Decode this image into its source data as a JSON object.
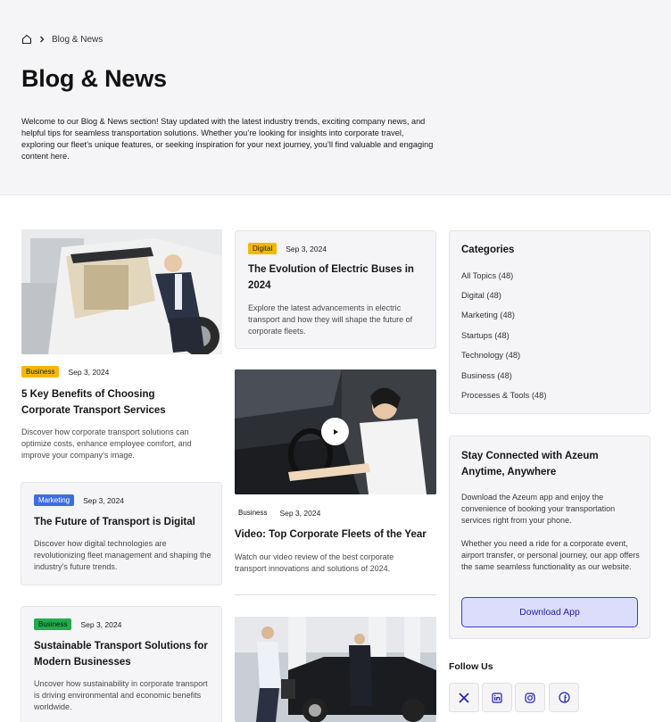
{
  "breadcrumb": {
    "home_icon": "home-icon",
    "separator_icon": "chevron-right-icon",
    "current": "Blog & News"
  },
  "page": {
    "title": "Blog & News",
    "intro": "Welcome to our Blog & News section! Stay updated with the latest industry trends, exciting company news, and helpful tips for seamless transportation solutions. Whether you’re looking for insights into corporate travel, exploring our fleet’s unique features, or seeking inspiration for your next journey, you’ll find valuable and engaging content here."
  },
  "posts": {
    "left": [
      {
        "tag": "Business",
        "date": "Sep 3, 2024",
        "title": "5 Key Benefits of Choosing Corporate Transport Services",
        "excerpt": "Discover how corporate transport solutions can optimize costs, enhance employee comfort, and improve your company’s image."
      },
      {
        "tag": "Marketing",
        "date": "Sep 3, 2024",
        "title": "The Future of Transport is Digital",
        "excerpt": "Discover how digital technologies are revolutionizing fleet management and shaping the industry’s future trends."
      },
      {
        "tag": "Business",
        "date": "Sep 3, 2024",
        "title": "Sustainable Transport Solutions for Modern Businesses",
        "excerpt": "Uncover how sustainability in corporate transport is driving environmental and economic benefits worldwide."
      }
    ],
    "middle": [
      {
        "tag": "Digital",
        "date": "Sep 3, 2024",
        "title": "The Evolution of Electric Buses in 2024",
        "excerpt": "Explore the latest advancements in electric transport and how they will shape the future of corporate fleets."
      },
      {
        "tag": "Business",
        "date": "Sep 3, 2024",
        "title": "Video: Top Corporate Fleets of the Year",
        "excerpt": "Watch our video review of the best corporate transport innovations and solutions of 2024."
      }
    ]
  },
  "sidebar": {
    "categories_title": "Categories",
    "categories": [
      "All Topics (48)",
      "Digital (48)",
      "Marketing (48)",
      "Startups (48)",
      "Technology (48)",
      "Business (48)",
      "Processes & Tools (48)"
    ],
    "app": {
      "title": "Stay Connected with Azeum Anytime, Anywhere",
      "p1": "Download the Azeum app and enjoy the convenience of booking your transportation services right from your phone.",
      "p2": "Whether you need a ride for a corporate event, airport transfer, or personal journey, our app offers the same seamless functionality as our website.",
      "button": "Download App"
    },
    "follow_title": "Follow Us",
    "social_icons": [
      "x-icon",
      "linkedin-icon",
      "instagram-icon",
      "facebook-icon"
    ]
  },
  "colors": {
    "accent": "#3a3ad6",
    "tag_yellow": "#f5b800",
    "tag_blue": "#3a6fe0",
    "tag_green": "#1fae4b"
  }
}
